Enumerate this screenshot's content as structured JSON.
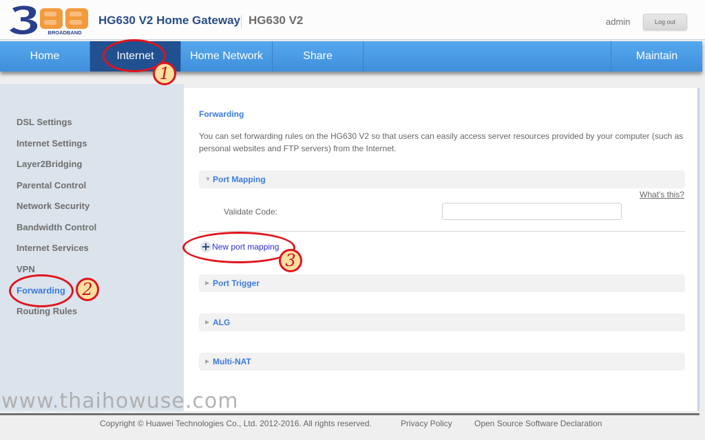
{
  "header": {
    "logo_alt": "3BB Broadband",
    "logo_colors": {
      "three": "#2a3f8c",
      "bb": "#f39a3c"
    },
    "logo_text_broadband": "BROADBAND",
    "title": "HG630 V2 Home Gateway",
    "subtitle": "HG630 V2",
    "user": "admin",
    "logout_label": "Log out"
  },
  "nav": {
    "items": [
      {
        "label": "Home",
        "active": false
      },
      {
        "label": "Internet",
        "active": true
      },
      {
        "label": "Home Network",
        "active": false
      },
      {
        "label": "Share",
        "active": false
      },
      {
        "label": "Maintain",
        "active": false
      }
    ],
    "colors": {
      "bar": "#4a9be6",
      "active": "#20508f"
    }
  },
  "sidebar": {
    "items": [
      {
        "label": "DSL Settings",
        "active": false
      },
      {
        "label": "Internet Settings",
        "active": false
      },
      {
        "label": "Layer2Bridging",
        "active": false
      },
      {
        "label": "Parental Control",
        "active": false
      },
      {
        "label": "Network Security",
        "active": false
      },
      {
        "label": "Bandwidth Control",
        "active": false
      },
      {
        "label": "Internet Services",
        "active": false
      },
      {
        "label": "VPN",
        "active": false
      },
      {
        "label": "Forwarding",
        "active": true
      },
      {
        "label": "Routing Rules",
        "active": false
      }
    ]
  },
  "content": {
    "title": "Forwarding",
    "description": "You can set forwarding rules on the HG630 V2 so that users can easily access server resources provided by your computer (such as personal websites and FTP servers) from the Internet.",
    "sections": [
      {
        "label": "Port Mapping",
        "expanded": true
      },
      {
        "label": "Port Trigger",
        "expanded": false
      },
      {
        "label": "ALG",
        "expanded": false
      },
      {
        "label": "Multi-NAT",
        "expanded": false
      }
    ],
    "whats_this": "What's this?",
    "validate_code_label": "Validate Code:",
    "validate_code_value": "",
    "new_port_mapping": "New port mapping",
    "accent": "#3b7be0"
  },
  "annotations": [
    {
      "number": "1",
      "target": "Internet"
    },
    {
      "number": "2",
      "target": "Forwarding"
    },
    {
      "number": "3",
      "target": "New port mapping"
    }
  ],
  "watermark": "www.thaihowuse.com",
  "footer": {
    "copyright": "Copyright © Huawei Technologies Co., Ltd. 2012-2016. All rights reserved.",
    "privacy": "Privacy Policy",
    "oss": "Open Source Software Declaration"
  }
}
